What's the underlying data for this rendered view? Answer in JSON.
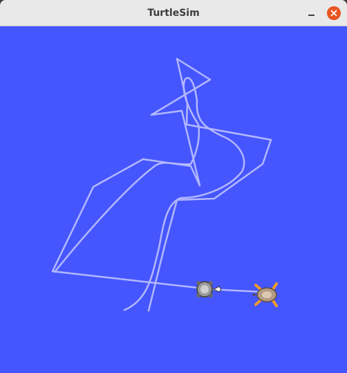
{
  "window": {
    "title": "TurtleSim"
  },
  "colors": {
    "background": "#4556ff",
    "pen": "#b3b8ff",
    "titlebar": "#e9e9e9",
    "close_button": "#e95420"
  },
  "icons": {
    "minimize": "minimize-icon",
    "close": "close-icon",
    "turtles": [
      "turtle-icon",
      "turtle-icon"
    ]
  }
}
